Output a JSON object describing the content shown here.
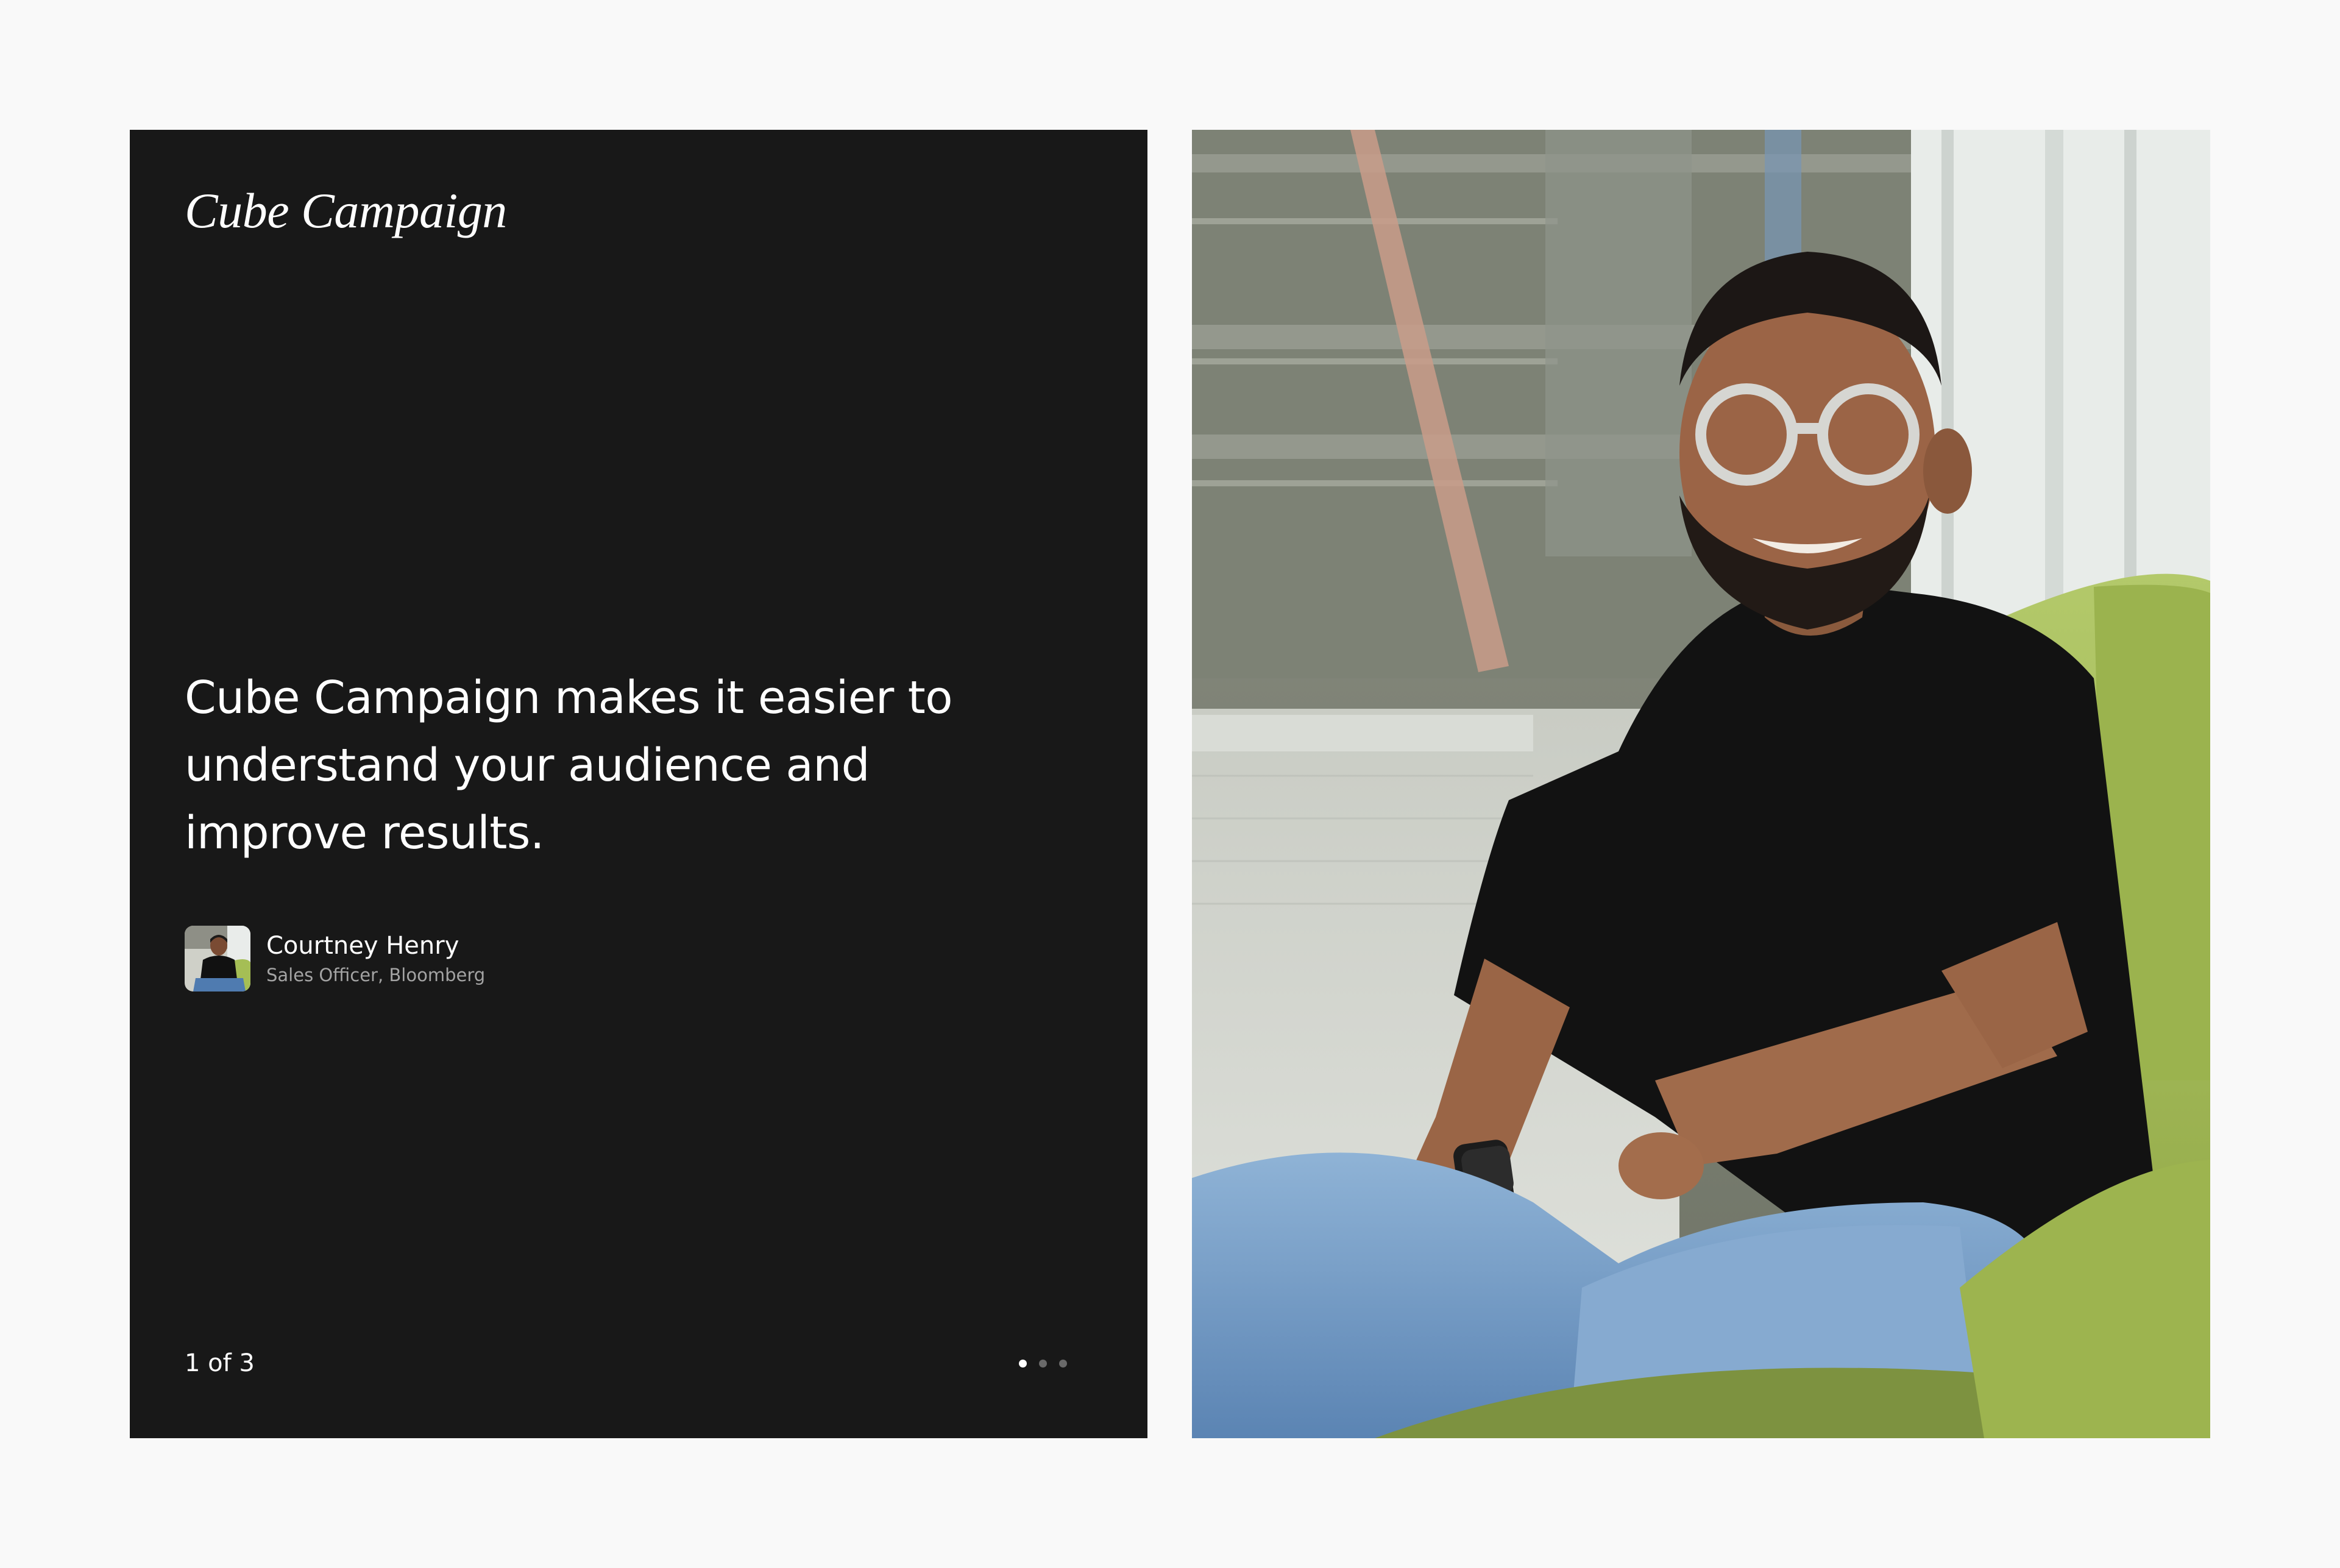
{
  "brand": {
    "logo_text": "Cube Campaign"
  },
  "testimonial": {
    "quote": "Cube Campaign makes it easier to understand your audience and improve results.",
    "author_name": "Courtney Henry",
    "author_role": "Sales Officer, Bloomberg"
  },
  "pagination": {
    "counter": "1 of 3",
    "current": 1,
    "total": 3
  },
  "colors": {
    "page_background": "#f9f9f9",
    "panel_background": "#181818",
    "text_primary": "#ffffff",
    "text_secondary": "#a3a3a3",
    "dot_inactive": "#6a6a6a",
    "chair_green": "#a5be55"
  },
  "icons": [
    "avatar-photo",
    "testimonial-photo",
    "pagination-dot"
  ]
}
